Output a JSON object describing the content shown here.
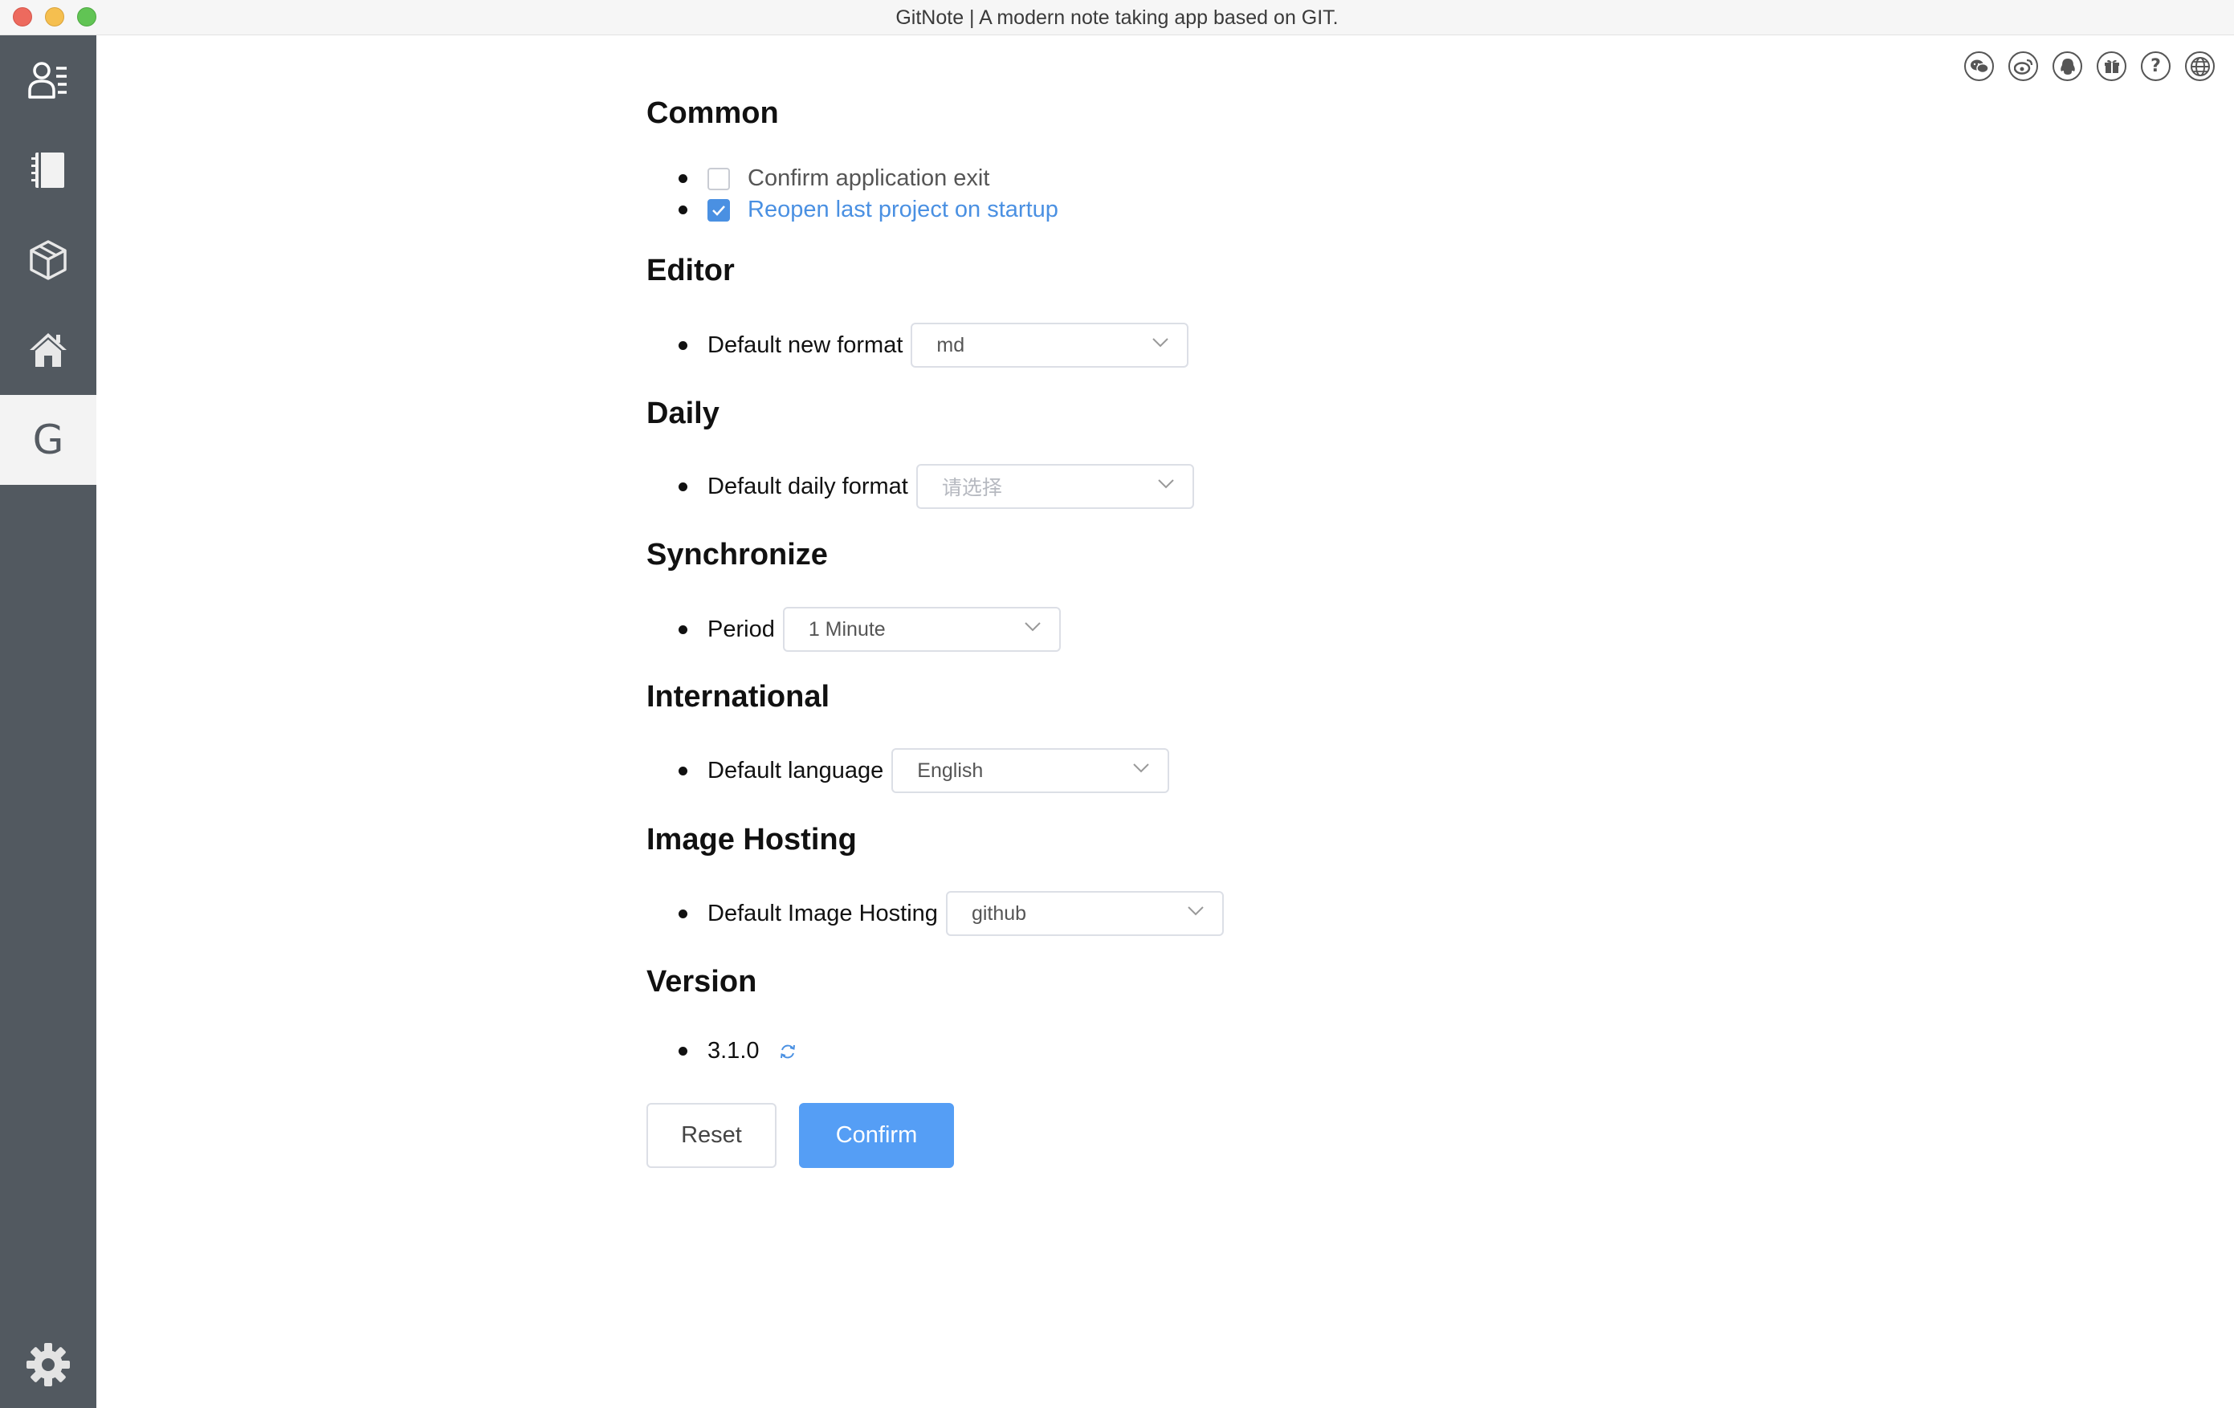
{
  "window": {
    "title": "GitNote | A modern note taking app based on GIT."
  },
  "sidebar": {
    "items": [
      {
        "name": "profile-list",
        "icon": "profile-list-icon"
      },
      {
        "name": "notebook",
        "icon": "notebook-icon"
      },
      {
        "name": "package",
        "icon": "cube-icon"
      },
      {
        "name": "home",
        "icon": "home-icon"
      },
      {
        "name": "gitnote",
        "label": "G",
        "active": true
      }
    ],
    "settings_icon": "gear-icon"
  },
  "top_icons": [
    "wechat-icon",
    "weibo-icon",
    "qq-icon",
    "gift-icon",
    "help-icon",
    "globe-icon"
  ],
  "sections": {
    "common": {
      "title": "Common",
      "confirm_exit": {
        "label": "Confirm application exit",
        "checked": false
      },
      "reopen_last": {
        "label": "Reopen last project on startup",
        "checked": true
      }
    },
    "editor": {
      "title": "Editor",
      "label": "Default new format",
      "value": "md"
    },
    "daily": {
      "title": "Daily",
      "label": "Default daily format",
      "placeholder": "请选择"
    },
    "synchronize": {
      "title": "Synchronize",
      "label": "Period",
      "value": "1 Minute"
    },
    "international": {
      "title": "International",
      "label": "Default language",
      "value": "English"
    },
    "image_hosting": {
      "title": "Image Hosting",
      "label": "Default Image Hosting",
      "value": "github"
    },
    "version": {
      "title": "Version",
      "value": "3.1.0"
    }
  },
  "buttons": {
    "reset": "Reset",
    "confirm": "Confirm"
  },
  "colors": {
    "sidebar": "#525960",
    "accent": "#4a90e2",
    "confirm_button": "#559ef5"
  }
}
